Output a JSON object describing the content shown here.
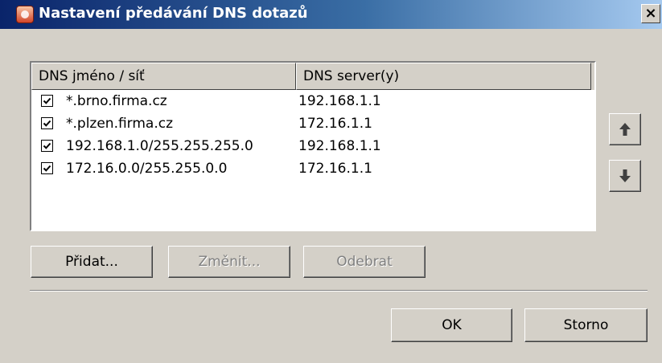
{
  "window": {
    "title": "Nastavení předávání DNS dotazů",
    "close_label": "×"
  },
  "list": {
    "columns": [
      "DNS jméno / síť",
      "DNS server(y)"
    ],
    "rows": [
      {
        "checked": true,
        "name": "*.brno.firma.cz",
        "server": "192.168.1.1"
      },
      {
        "checked": true,
        "name": "*.plzen.firma.cz",
        "server": "172.16.1.1"
      },
      {
        "checked": true,
        "name": "192.168.1.0/255.255.255.0",
        "server": "192.168.1.1"
      },
      {
        "checked": true,
        "name": "172.16.0.0/255.255.0.0",
        "server": "172.16.1.1"
      }
    ]
  },
  "buttons": {
    "add": "Přidat...",
    "change": "Změnit...",
    "remove": "Odebrat",
    "ok": "OK",
    "cancel": "Storno"
  },
  "icons": {
    "move_up": "arrow-up-icon",
    "move_down": "arrow-down-icon",
    "app": "app-icon"
  },
  "colors": {
    "titlebar_start": "#0a246a",
    "titlebar_end": "#a6caf0",
    "face": "#d4d0c8"
  }
}
